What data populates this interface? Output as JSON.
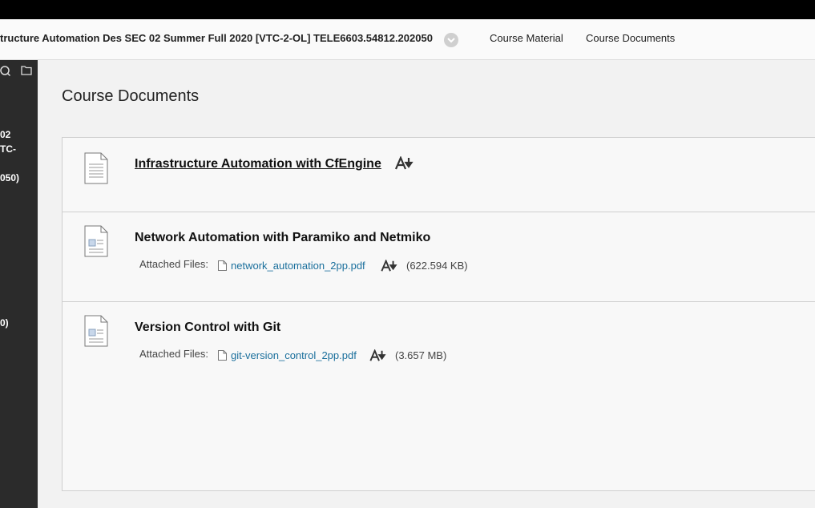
{
  "header": {
    "course_title": "tructure Automation Des SEC 02 Summer Full 2020 [VTC-2-OL] TELE6603.54812.202050",
    "nav": [
      {
        "label": "Course Material"
      },
      {
        "label": "Course Documents"
      }
    ]
  },
  "sidebar": {
    "text_lines": [
      "02",
      "TC-",
      "050)",
      "0)"
    ]
  },
  "main": {
    "page_title": "Course Documents",
    "items": [
      {
        "title": "Infrastructure Automation with CfEngine"
      },
      {
        "title": "Network Automation with Paramiko and Netmiko",
        "attached_label": "Attached Files:",
        "file_name": "network_automation_2pp.pdf",
        "file_size": "(622.594 KB)"
      },
      {
        "title": "Version Control with Git",
        "attached_label": "Attached Files:",
        "file_name": "git-version_control_2pp.pdf",
        "file_size": "(3.657 MB)"
      }
    ]
  },
  "colors": {
    "link": "#1a6f9c",
    "sidebar": "#2b2b2b",
    "topbar": "#000000"
  },
  "icons": [
    "search-icon",
    "folder-icon",
    "chevron-down-icon",
    "document-icon",
    "accessibility-download-icon",
    "pdf-file-icon"
  ]
}
